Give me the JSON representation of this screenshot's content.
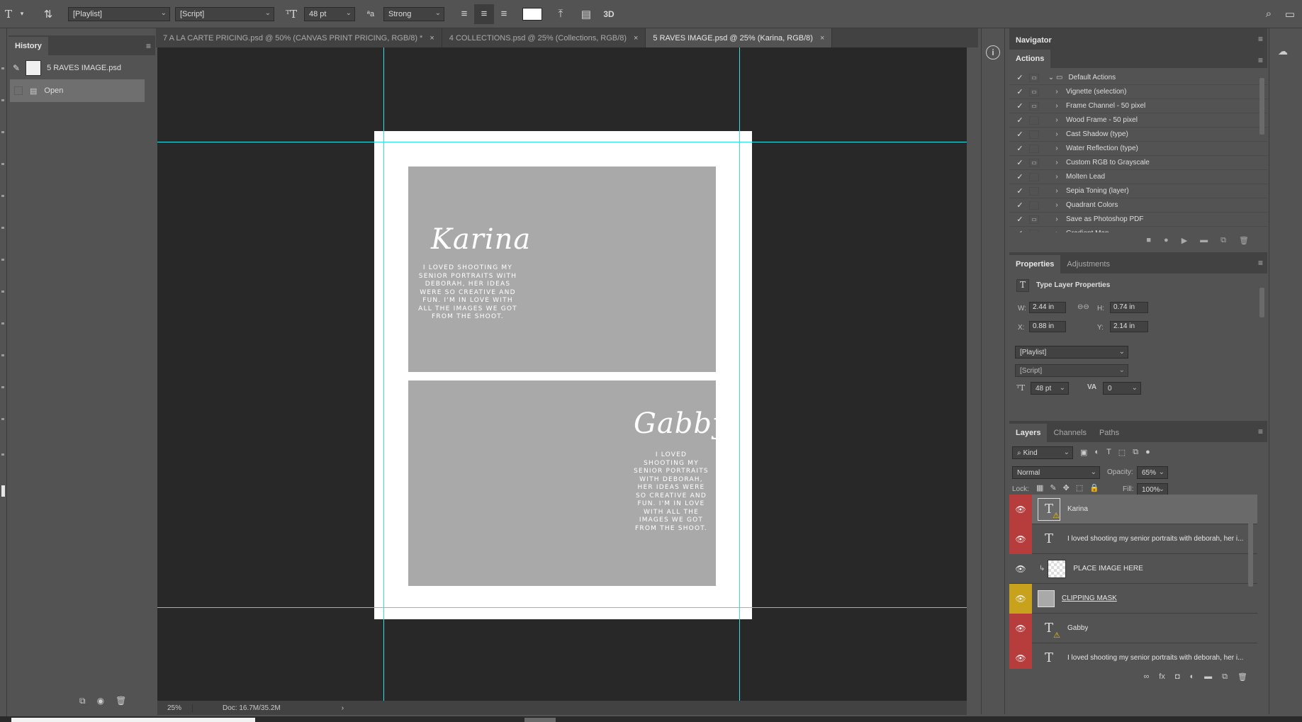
{
  "options_bar": {
    "font_family": "[Playlist]",
    "font_style": "[Script]",
    "font_size": "48 pt",
    "anti_alias": "Strong",
    "text_color": "#ffffff",
    "mode_3d": "3D"
  },
  "history": {
    "tab": "History",
    "snapshot_name": "5 RAVES IMAGE.psd",
    "steps": [
      "Open"
    ]
  },
  "doc_tabs": [
    {
      "label": "7 A LA CARTE PRICING.psd @ 50% (CANVAS PRINT PRICING, RGB/8) *",
      "active": false
    },
    {
      "label": "4 COLLECTIONS.psd @ 25% (Collections, RGB/8)",
      "active": false
    },
    {
      "label": "5 RAVES IMAGE.psd @ 25% (Karina, RGB/8)",
      "active": true
    }
  ],
  "canvas": {
    "name_top": "Karina",
    "quote_top": "I LOVED SHOOTING MY SENIOR PORTRAITS WITH DEBORAH, HER IDEAS WERE SO CREATIVE AND FUN. I'M IN LOVE WITH ALL THE IMAGES WE GOT FROM THE SHOOT.",
    "name_bottom": "Gabby",
    "quote_bottom": "I LOVED SHOOTING MY SENIOR PORTRAITS WITH DEBORAH, HER IDEAS WERE SO CREATIVE AND FUN. I'M IN LOVE WITH ALL THE IMAGES WE GOT FROM THE SHOOT."
  },
  "status": {
    "zoom": "25%",
    "doc": "Doc: 16.7M/35.2M"
  },
  "navigator": {
    "tab": "Navigator"
  },
  "actions": {
    "tab": "Actions",
    "set_name": "Default Actions",
    "items": [
      {
        "label": "Vignette (selection)",
        "dialog": true
      },
      {
        "label": "Frame Channel - 50 pixel",
        "dialog": true
      },
      {
        "label": "Wood Frame - 50 pixel",
        "dialog": false
      },
      {
        "label": "Cast Shadow (type)",
        "dialog": false
      },
      {
        "label": "Water Reflection (type)",
        "dialog": false
      },
      {
        "label": "Custom RGB to Grayscale",
        "dialog": true
      },
      {
        "label": "Molten Lead",
        "dialog": false
      },
      {
        "label": "Sepia Toning (layer)",
        "dialog": false
      },
      {
        "label": "Quadrant Colors",
        "dialog": false
      },
      {
        "label": "Save as Photoshop PDF",
        "dialog": true
      },
      {
        "label": "Gradient Map",
        "dialog": false
      }
    ]
  },
  "properties": {
    "tab_active": "Properties",
    "tab_other": "Adjustments",
    "title": "Type Layer Properties",
    "w_label": "W:",
    "w": "2.44 in",
    "h_label": "H:",
    "h": "0.74 in",
    "x_label": "X:",
    "x": "0.88 in",
    "y_label": "Y:",
    "y": "2.14 in",
    "font_family": "[Playlist]",
    "font_style": "[Script]",
    "font_size": "48 pt",
    "tracking": "0"
  },
  "layers": {
    "tabs": [
      "Layers",
      "Channels",
      "Paths"
    ],
    "filter": "Kind",
    "blend_mode": "Normal",
    "opacity_label": "Opacity:",
    "opacity": "65%",
    "lock_label": "Lock:",
    "fill_label": "Fill:",
    "fill": "100%",
    "items": [
      {
        "name": "Karina",
        "type": "text",
        "eye": "red",
        "selected": true,
        "warning": true
      },
      {
        "name": "I loved shooting my senior portraits with deborah, her i...",
        "type": "text",
        "eye": "red",
        "selected": false,
        "warning": false
      },
      {
        "name": "PLACE IMAGE HERE",
        "type": "image",
        "eye": "none",
        "selected": false,
        "warning": false
      },
      {
        "name": "CLIPPING MASK",
        "type": "shape",
        "eye": "yellow",
        "selected": false,
        "warning": false
      },
      {
        "name": "Gabby",
        "type": "text",
        "eye": "red",
        "selected": false,
        "warning": true
      },
      {
        "name": "I loved shooting my senior portraits with deborah, her i...",
        "type": "text",
        "eye": "red",
        "selected": false,
        "warning": false
      }
    ]
  },
  "colors": {
    "guide": "#30e0e8",
    "photo_fill": "#a9a9a9",
    "eye_red": "#b73c3c",
    "eye_yellow": "#c9a21d"
  }
}
